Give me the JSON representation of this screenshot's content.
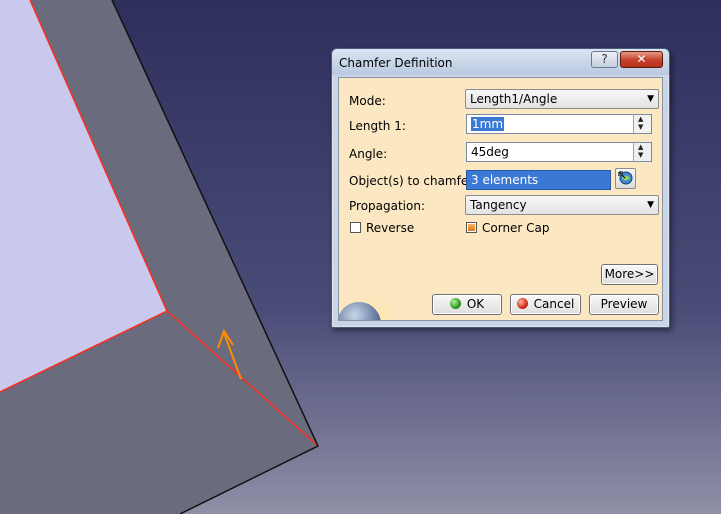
{
  "dialog": {
    "title": "Chamfer Definition",
    "help_label": "?",
    "close_label": "✕",
    "mode": {
      "label": "Mode:",
      "value": "Length1/Angle"
    },
    "length1": {
      "label": "Length 1:",
      "value": "1mm"
    },
    "angle": {
      "label": "Angle:",
      "value": "45deg"
    },
    "objects": {
      "label": "Object(s) to chamfer:",
      "value": "3 elements"
    },
    "propagation": {
      "label": "Propagation:",
      "value": "Tangency"
    },
    "reverse": {
      "label": "Reverse",
      "checked": false
    },
    "corner_cap": {
      "label": "Corner Cap",
      "checked": true
    },
    "more_label": "More>>",
    "ok_label": "OK",
    "cancel_label": "Cancel",
    "preview_label": "Preview"
  },
  "colors": {
    "background_top": "#2e2f5c",
    "background_bottom": "#8f8fa6",
    "face_light": "#c9c9ee",
    "face_dark": "#6a6c7e",
    "edge_highlight": "#ff2a1a",
    "arrow": "#ff8c00",
    "dialog_client": "#fbe8c2",
    "selection": "#3a78d6"
  }
}
